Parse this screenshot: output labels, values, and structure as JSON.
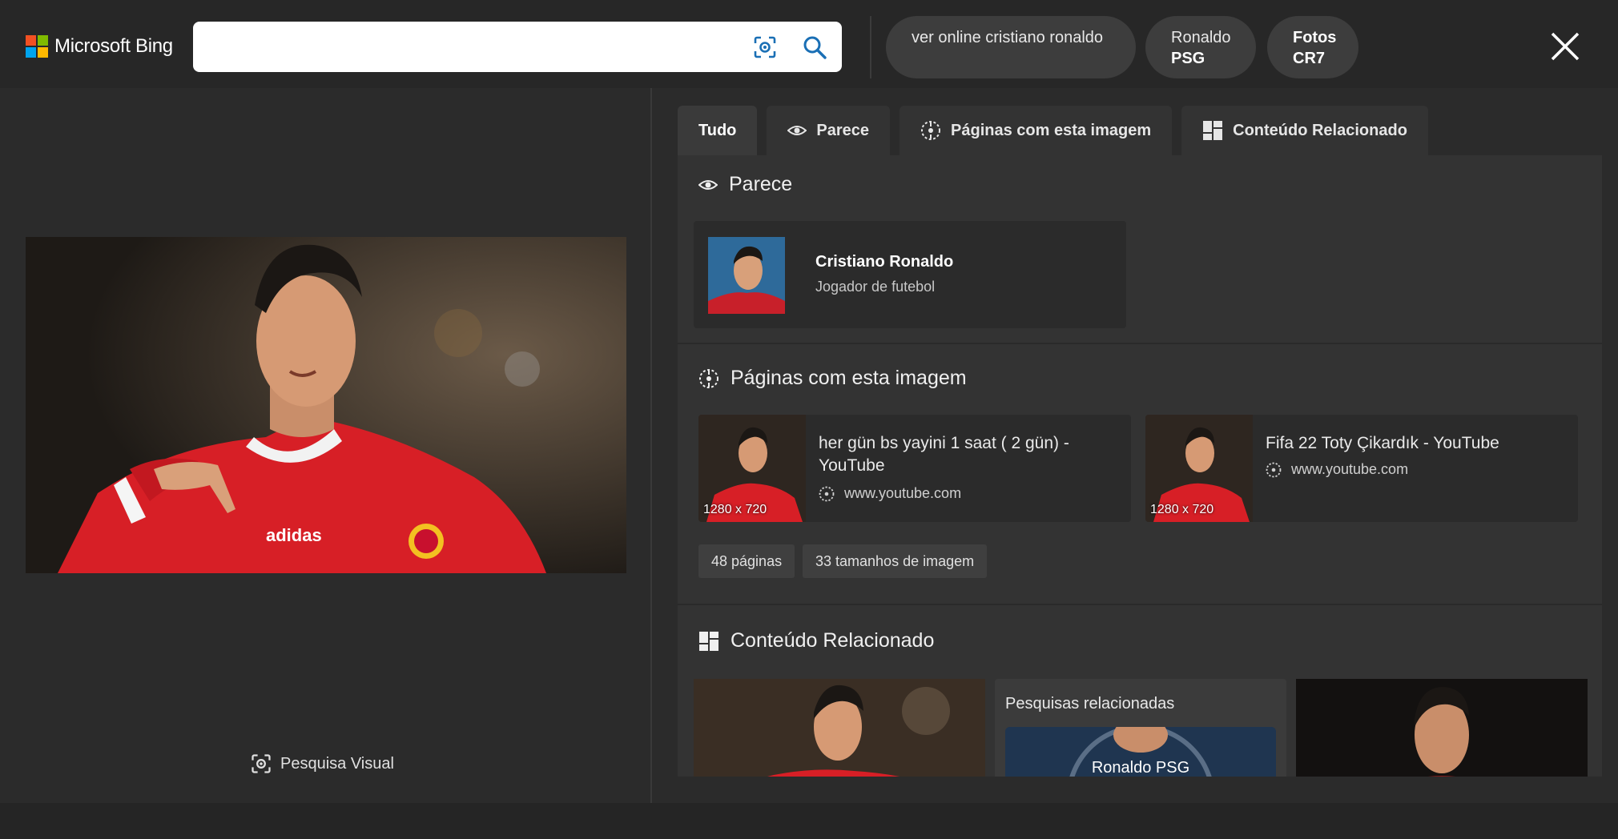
{
  "header": {
    "brand": "Microsoft Bing",
    "search_value": "",
    "chips": [
      {
        "line1": "ver online cristiano ronaldo",
        "line2": ""
      },
      {
        "line1": "Ronaldo",
        "line2": "PSG"
      },
      {
        "line1": "Fotos",
        "line2": "CR7"
      }
    ]
  },
  "left": {
    "visual_search_label": "Pesquisa Visual"
  },
  "tabs": [
    {
      "label": "Tudo"
    },
    {
      "label": "Parece"
    },
    {
      "label": "Páginas com esta imagem"
    },
    {
      "label": "Conteúdo Relacionado"
    }
  ],
  "parece": {
    "title": "Parece",
    "entity_name": "Cristiano Ronaldo",
    "entity_sub": "Jogador de futebol"
  },
  "pages": {
    "title": "Páginas com esta imagem",
    "items": [
      {
        "title": "her gün bs yayini 1 saat ( 2 gün) - YouTube",
        "site": "www.youtube.com",
        "size": "1280 x 720"
      },
      {
        "title": "Fifa 22 Toty Çikardık - YouTube",
        "site": "www.youtube.com",
        "size": "1280 x 720"
      }
    ],
    "count_pill": "48 páginas",
    "sizes_pill": "33 tamanhos de imagem"
  },
  "related": {
    "title": "Conteúdo Relacionado",
    "searches_title": "Pesquisas relacionadas",
    "searches_item": "Ronaldo PSG"
  },
  "colors": {
    "background": "#2b2b2b",
    "panel": "#333333",
    "header": "#272727"
  }
}
